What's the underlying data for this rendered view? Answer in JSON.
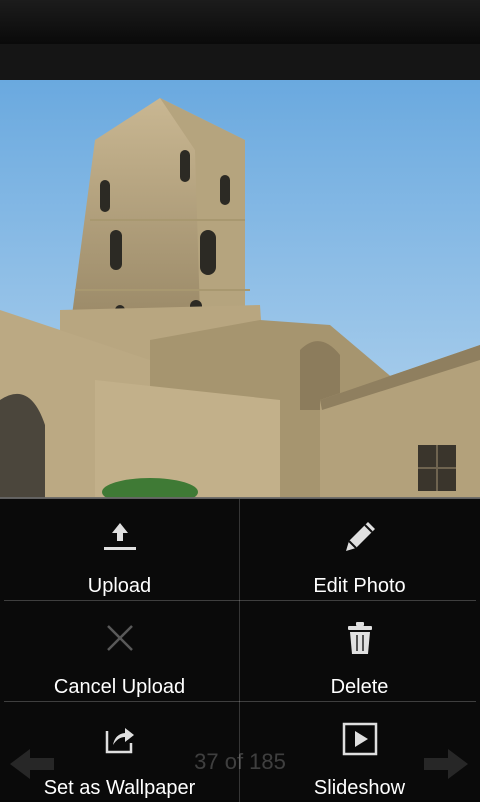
{
  "footer": {
    "counter": "37 of 185"
  },
  "menu": {
    "upload_label": "Upload",
    "edit_photo_label": "Edit Photo",
    "cancel_upload_label": "Cancel Upload",
    "delete_label": "Delete",
    "set_wallpaper_label": "Set as Wallpaper",
    "slideshow_label": "Slideshow"
  },
  "icons": {
    "upload": "upload-icon",
    "edit": "pencil-icon",
    "cancel": "close-icon",
    "delete": "trash-icon",
    "wallpaper": "share-icon",
    "slideshow": "play-icon"
  },
  "colors": {
    "menu_text": "#ffffff",
    "menu_icon": "#e0e0e0",
    "disabled_icon": "#9a9a9a"
  }
}
